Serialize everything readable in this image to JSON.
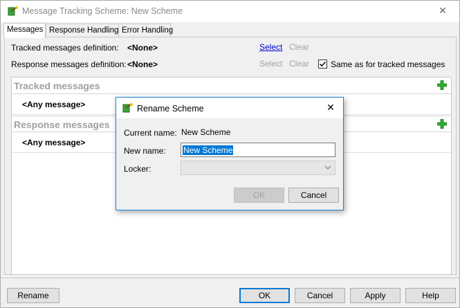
{
  "window": {
    "title": "Message Tracking Scheme: New Scheme",
    "close_glyph": "✕"
  },
  "tabs": [
    {
      "label": "Messages",
      "active": true
    },
    {
      "label": "Response Handling",
      "active": false
    },
    {
      "label": "Error Handling",
      "active": false
    }
  ],
  "definitions": {
    "tracked_label": "Tracked messages definition:",
    "tracked_value": "<None>",
    "response_label": "Response messages definition:",
    "response_value": "<None>",
    "select_label": "Select",
    "clear_label": "Clear",
    "same_as_label": "Same as for tracked messages",
    "same_as_checked": true
  },
  "sections": {
    "tracked_title": "Tracked messages",
    "tracked_row": "<Any message>",
    "response_title": "Response messages",
    "response_row": "<Any message>"
  },
  "buttons": {
    "rename": "Rename",
    "ok": "OK",
    "cancel": "Cancel",
    "apply": "Apply",
    "help": "Help"
  },
  "dialog": {
    "title": "Rename Scheme",
    "close_glyph": "✕",
    "current_name_label": "Current name:",
    "current_name_value": "New Scheme",
    "new_name_label": "New name:",
    "new_name_value": "New Scheme",
    "locker_label": "Locker:",
    "locker_value": "",
    "ok": "OK",
    "cancel": "Cancel"
  },
  "colors": {
    "accent": "#0078d7",
    "plus_green": "#2eaa2e",
    "link": "#0000cc"
  },
  "icons": {
    "app": "scheme-icon",
    "add": "plus-icon",
    "dropdown": "chevron-down-icon"
  }
}
